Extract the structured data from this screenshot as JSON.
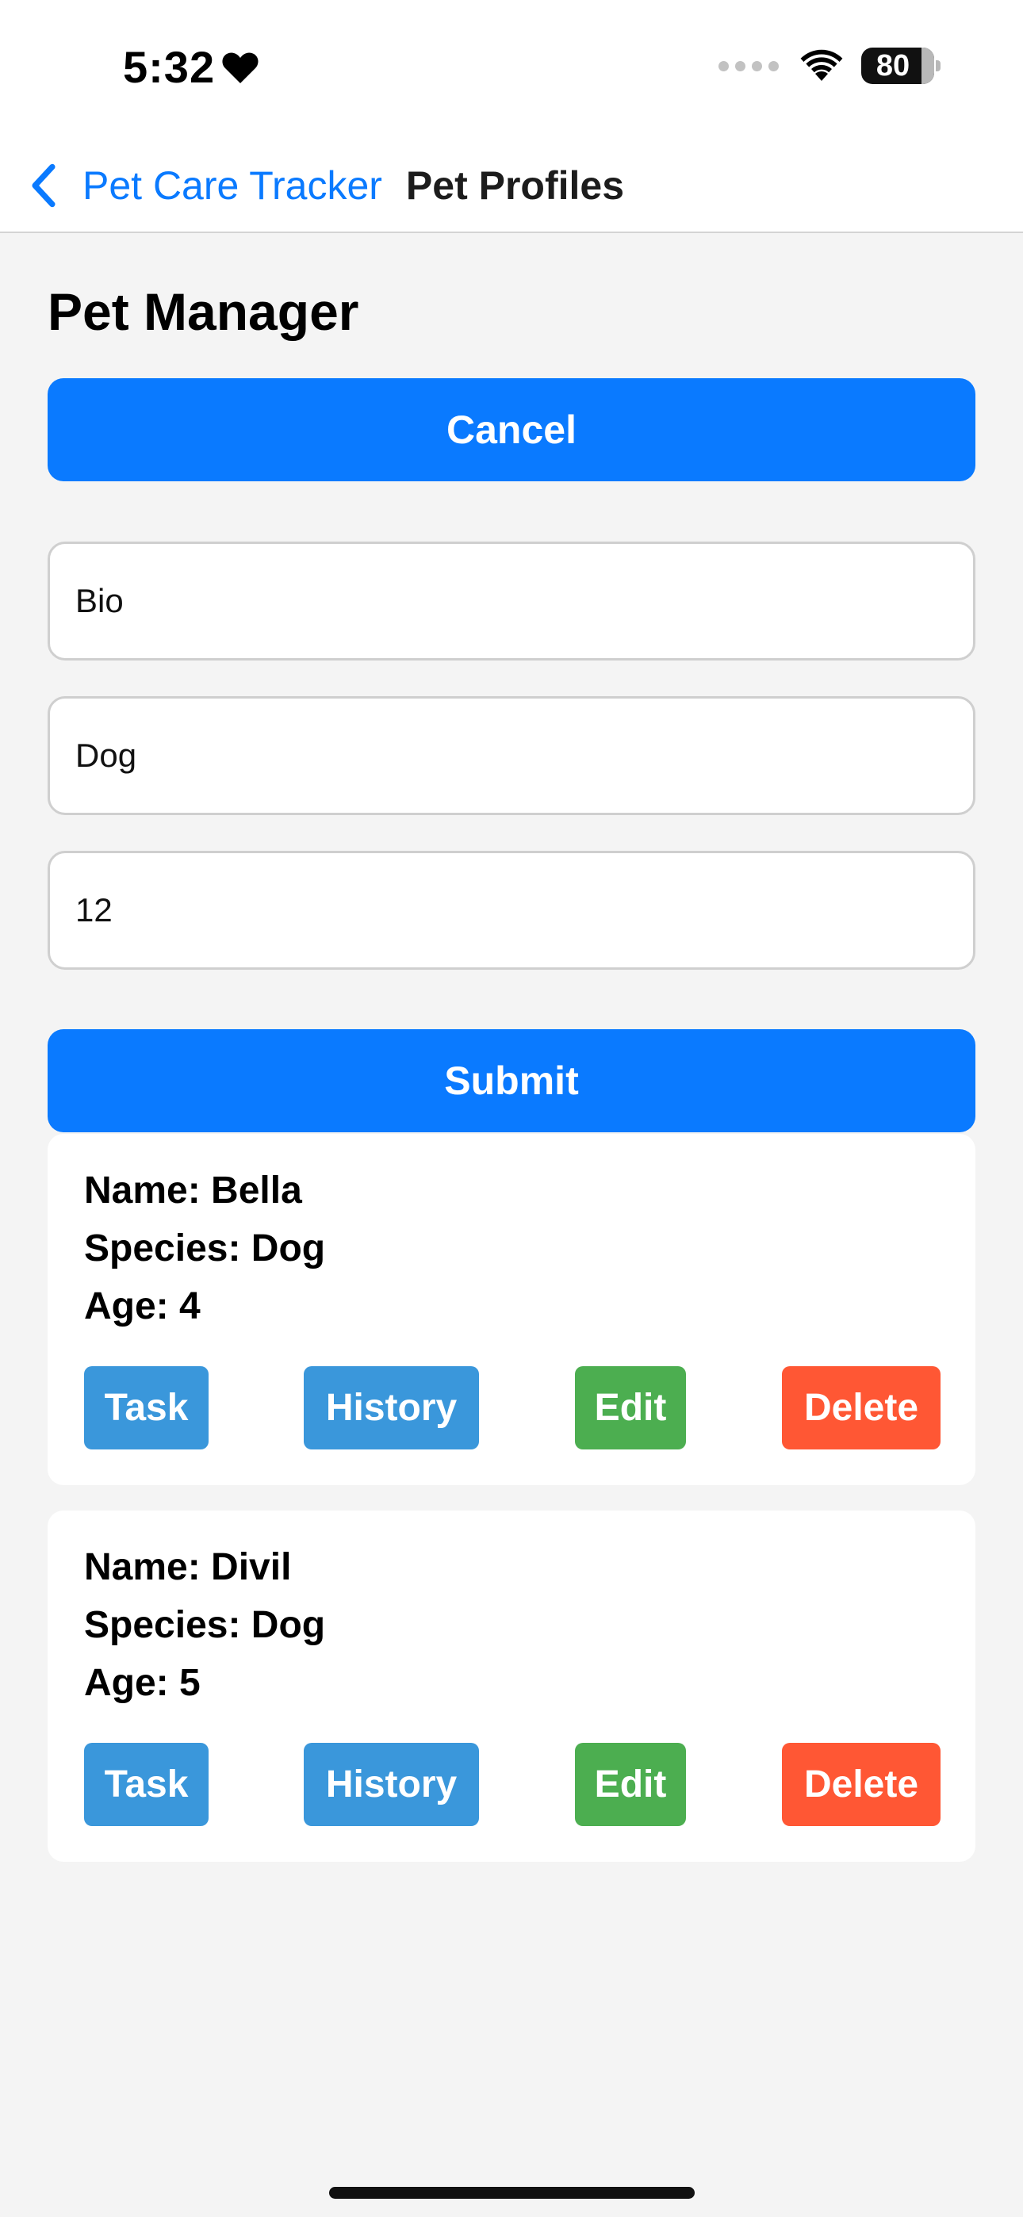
{
  "status_bar": {
    "time": "5:32",
    "battery": "80",
    "icons": [
      "heart-icon",
      "cellular-dots-icon",
      "wifi-icon",
      "battery-icon"
    ]
  },
  "nav": {
    "back_label": "Pet Care Tracker",
    "title": "Pet Profiles",
    "back_icon": "chevron-left-icon",
    "accent_color": "#0a7aff"
  },
  "page": {
    "title": "Pet Manager",
    "cancel_label": "Cancel",
    "submit_label": "Submit"
  },
  "form": {
    "name_value": "Bio",
    "species_value": "Dog",
    "age_value": "12"
  },
  "pets": [
    {
      "name": "Name: Bella",
      "species": "Species: Dog",
      "age": "Age: 4",
      "actions": {
        "task": "Task",
        "history": "History",
        "edit": "Edit",
        "delete": "Delete"
      }
    },
    {
      "name": "Name: Divil",
      "species": "Species: Dog",
      "age": "Age: 5",
      "actions": {
        "task": "Task",
        "history": "History",
        "edit": "Edit",
        "delete": "Delete"
      }
    }
  ],
  "colors": {
    "primary": "#0a7aff",
    "task_history": "#3a97db",
    "edit": "#4cae50",
    "delete": "#ff5734"
  }
}
